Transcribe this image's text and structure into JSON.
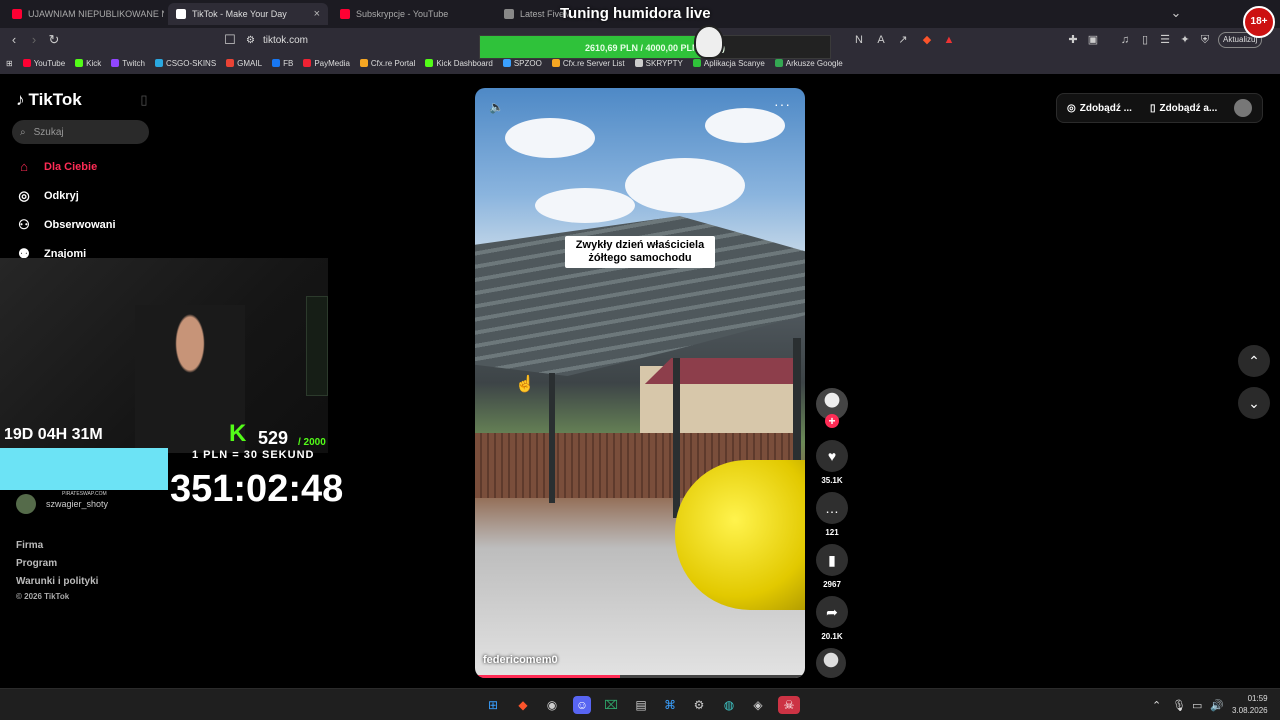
{
  "browser": {
    "tabs": [
      {
        "title": "UJAWNIAM NIEPUBLIKOWANE NAGRANIA",
        "color": "#ff0033"
      },
      {
        "title": "TikTok - Make Your Day",
        "color": "#ffffff"
      },
      {
        "title": "Subskrypcje - YouTube",
        "color": "#ff0033"
      },
      {
        "title": "Latest FiveM Re",
        "color": "#888888"
      }
    ],
    "url": "tiktok.com",
    "update_label": "Aktualizuj",
    "bookmarks": [
      "YouTube",
      "Kick",
      "Twitch",
      "CSGO-SKINS",
      "GMAIL",
      "FB",
      "PayMedia",
      "Cfx.re Portal",
      "Kick Dashboard",
      "SPZOO",
      "Cfx.re Server List",
      "SKRYPTY",
      "Aplikacja Scanye",
      "Arkusze Google"
    ]
  },
  "stream_overlay": {
    "title": "Tuning humidora live",
    "donation_text": "2610,69 PLN / 4000,00 PLN (27%)",
    "donation_progress": 0.65,
    "countdown": "19D 04H 31M",
    "kick_letter": "K",
    "kick_count": "529",
    "kick_goal": "/ 2000",
    "rate": "1 PLN = 30 SEKUND",
    "sponsor_caption": "PIRATESWAP.COM",
    "timer": "351:02:48",
    "age_badge": "18+"
  },
  "sidebar": {
    "logo": "TikTok",
    "search_placeholder": "Szukaj",
    "items": [
      {
        "label": "Dla Ciebie",
        "icon": "home-icon",
        "active": true
      },
      {
        "label": "Odkryj",
        "icon": "compass-icon",
        "active": false
      },
      {
        "label": "Obserwowani",
        "icon": "following-icon",
        "active": false
      },
      {
        "label": "Znajomi",
        "icon": "friends-icon",
        "active": false
      }
    ],
    "account": "szwagier_shoty",
    "footer_links": [
      "Firma",
      "Program",
      "Warunki i polityki"
    ],
    "copyright": "© 2026 TikTok"
  },
  "video": {
    "caption": "Zwykły dzień właściciela żółtego samochodu",
    "author": "federicomem0",
    "progress": 0.44
  },
  "actions": {
    "likes": "35.1K",
    "comments": "121",
    "saves": "2967",
    "shares": "20.1K"
  },
  "header_right": {
    "get_coins": "Zdobądź ...",
    "get_app": "Zdobądź a..."
  },
  "taskbar": {
    "time": "01:59",
    "date": "3.08.2026"
  }
}
